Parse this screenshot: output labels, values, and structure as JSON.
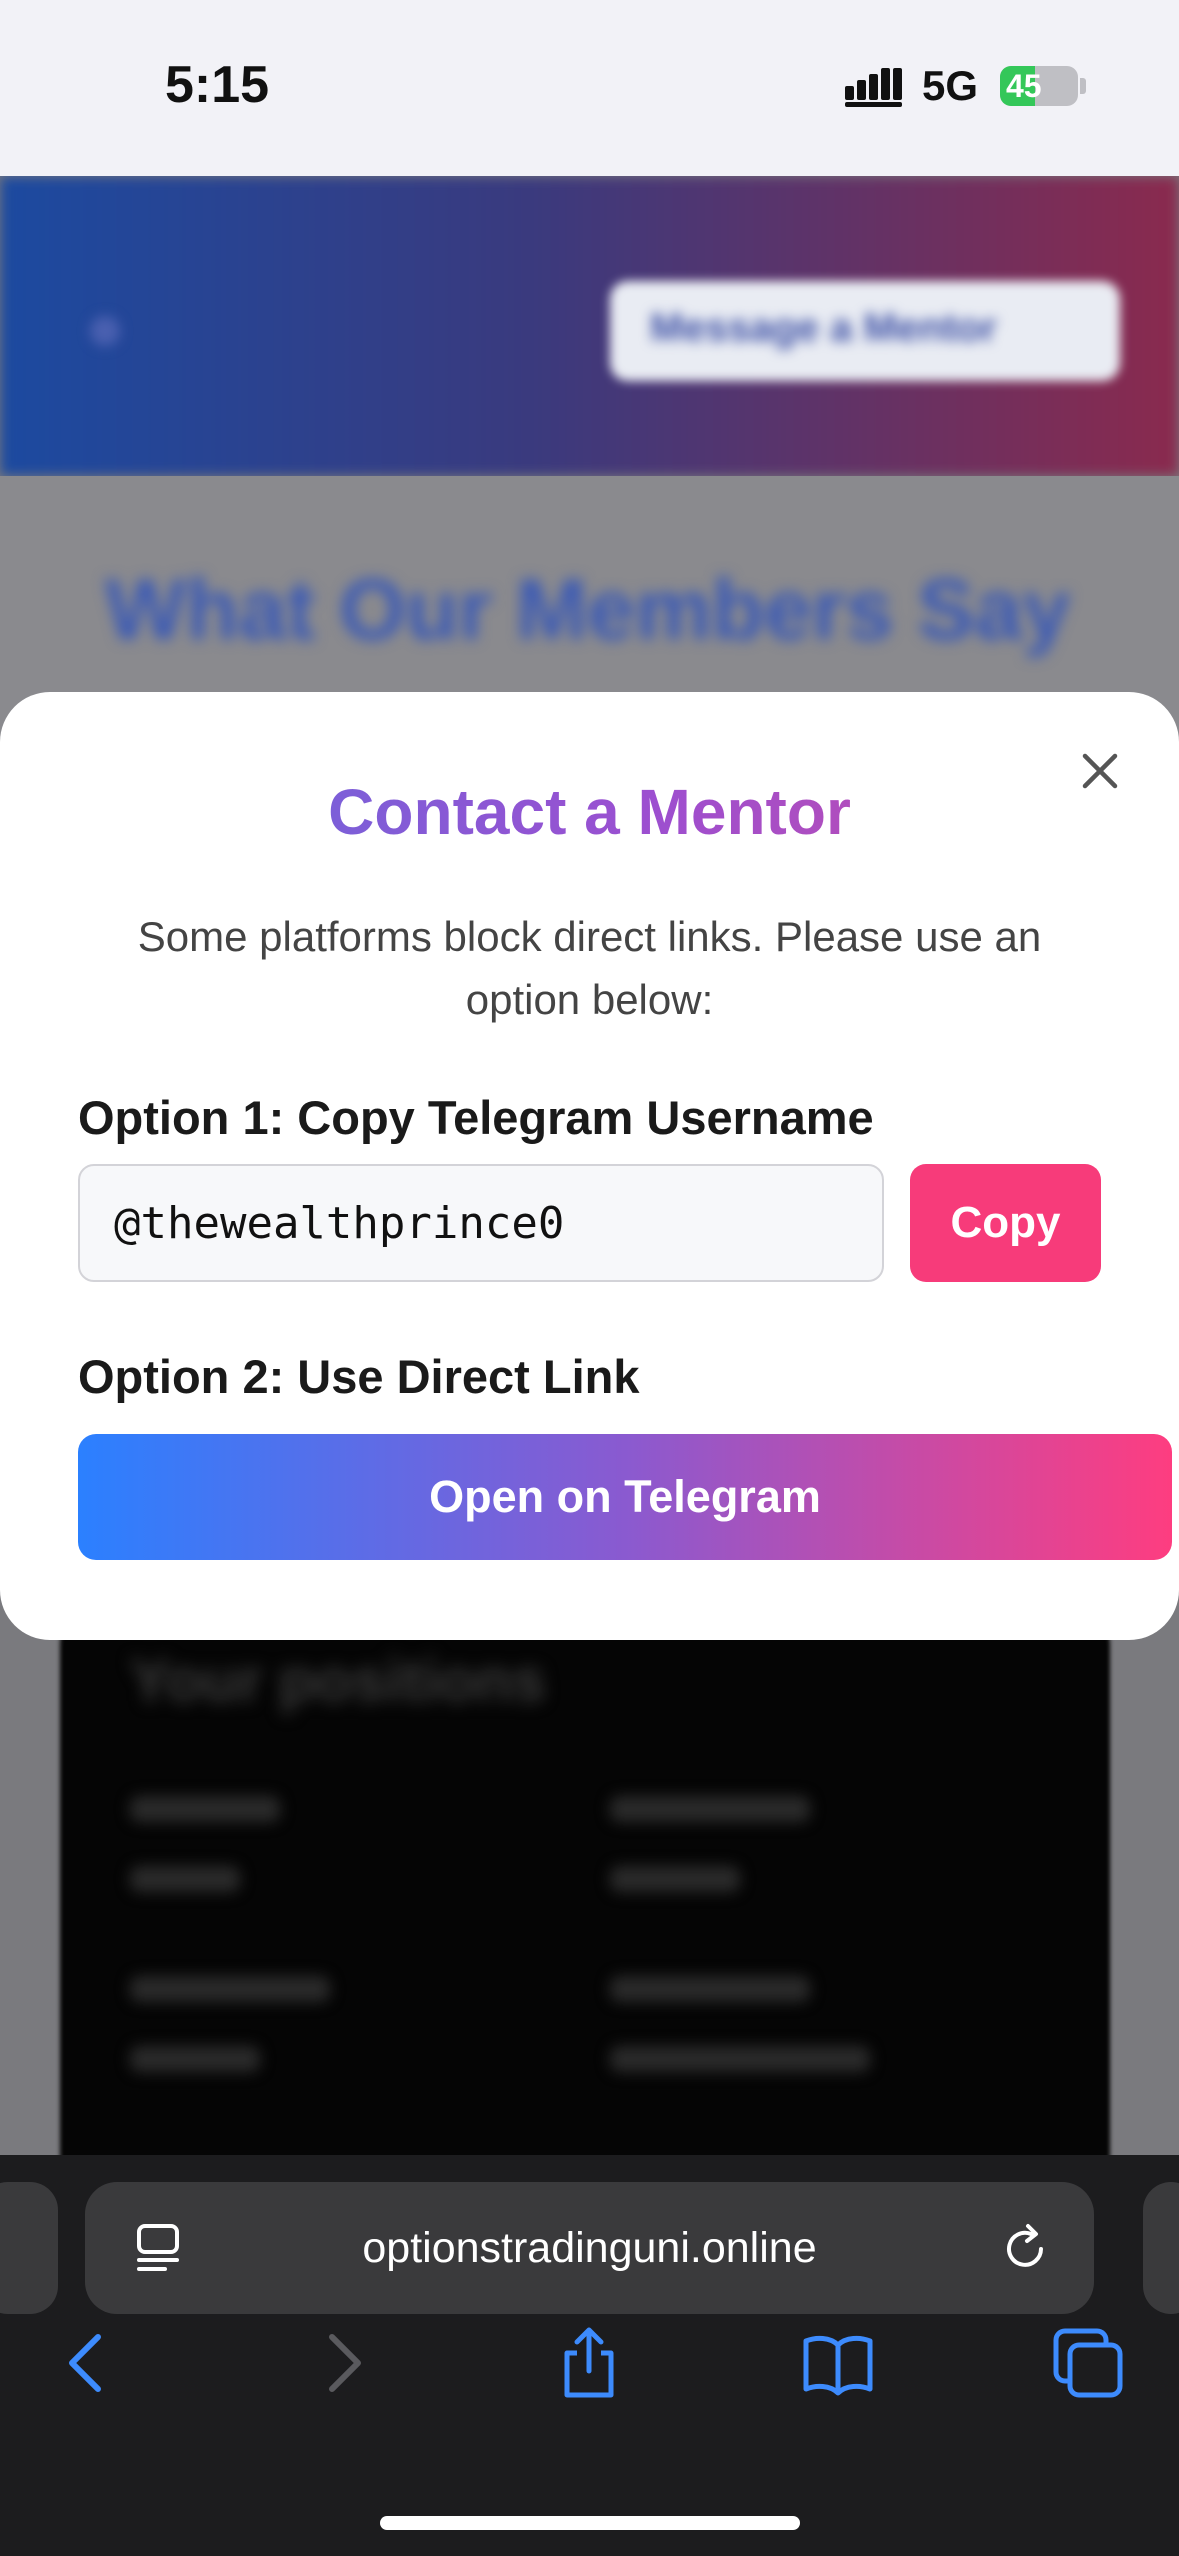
{
  "status_bar": {
    "time": "5:15",
    "network": "5G",
    "battery_percent": "45",
    "battery_level": 0.45,
    "battery_charging": true
  },
  "background_page": {
    "header_button": "Message a Mentor",
    "section_heading": "What Our Members Say",
    "card_title": "Your positions"
  },
  "modal": {
    "title": "Contact a Mentor",
    "description": "Some platforms block direct links. Please use an option below:",
    "option1_label": "Option 1: Copy Telegram Username",
    "username_value": "@thewealthprince0",
    "copy_label": "Copy",
    "option2_label": "Option 2: Use Direct Link",
    "telegram_button": "Open on Telegram"
  },
  "browser": {
    "url": "optionstradinguni.online",
    "icons": [
      "page-menu-icon",
      "reload-icon",
      "back-icon",
      "forward-icon",
      "share-icon",
      "bookmarks-icon",
      "tabs-icon"
    ]
  },
  "colors": {
    "accent_pink": "#f73b7a",
    "telegram_gradient_start": "#2b80ff",
    "telegram_gradient_end": "#fe3d80",
    "safari_blue": "#3d8bfd"
  }
}
